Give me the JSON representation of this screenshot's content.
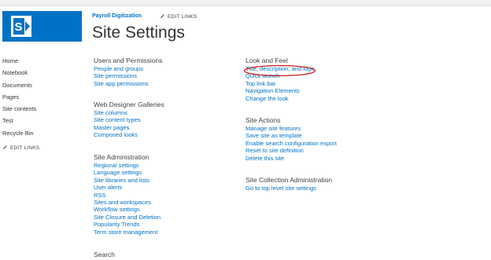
{
  "header": {
    "site_name": "Payroll Digitization",
    "edit_links": "EDIT LINKS",
    "page_title": "Site Settings"
  },
  "colors": {
    "accent": "#0072c6",
    "annotation": "#d01c1c"
  },
  "icons": {
    "logo": "sharepoint-logo-icon",
    "edit": "pencil-icon"
  },
  "left_nav": {
    "items": [
      "Home",
      "Notebook",
      "Documents",
      "Pages",
      "Site contents",
      "Test",
      "Recycle Bin"
    ],
    "edit_links": "EDIT LINKS"
  },
  "sections": {
    "users_permissions": {
      "title": "Users and Permissions",
      "links": [
        "People and groups",
        "Site permissions",
        "Site app permissions"
      ]
    },
    "web_designer_galleries": {
      "title": "Web Designer Galleries",
      "links": [
        "Site columns",
        "Site content types",
        "Master pages",
        "Composed looks"
      ]
    },
    "site_administration": {
      "title": "Site Administration",
      "links": [
        "Regional settings",
        "Language settings",
        "Site libraries and lists",
        "User alerts",
        "RSS",
        "Sites and workspaces",
        "Workflow settings",
        "Site Closure and Deletion",
        "Popularity Trends",
        "Term store management"
      ]
    },
    "search": {
      "title": "Search"
    },
    "look_and_feel": {
      "title": "Look and Feel",
      "links": [
        "Title, description, and logo",
        "Quick launch",
        "Top link bar",
        "Navigation Elements",
        "Change the look"
      ]
    },
    "site_actions": {
      "title": "Site Actions",
      "links": [
        "Manage site features",
        "Save site as template",
        "Enable search configuration export",
        "Reset to site definition",
        "Delete this site"
      ]
    },
    "site_collection_administration": {
      "title": "Site Collection Administration",
      "links": [
        "Go to top level site settings"
      ]
    }
  }
}
